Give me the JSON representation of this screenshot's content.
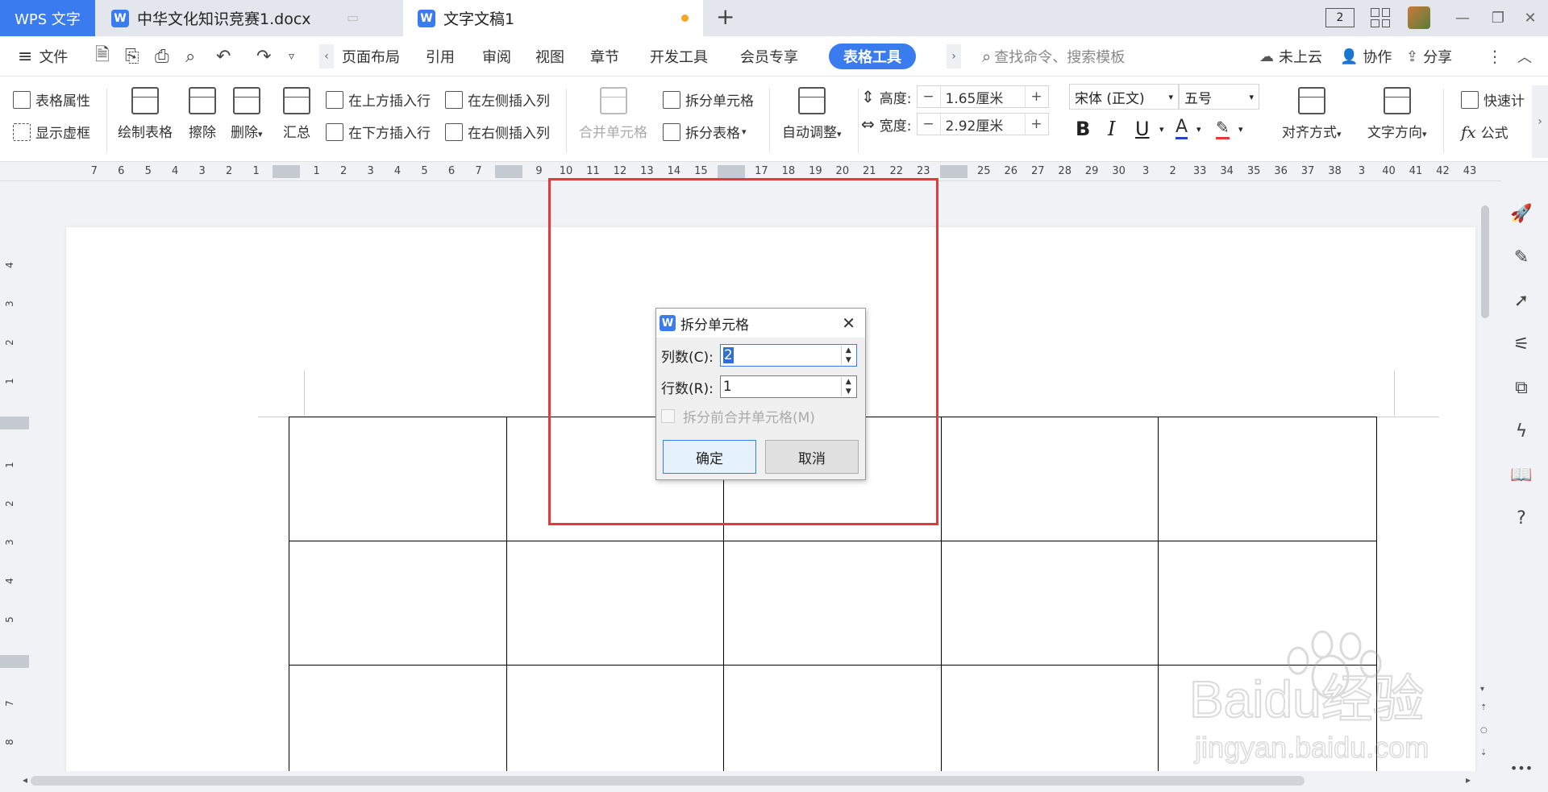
{
  "tabbar": {
    "app_label": "WPS 文字",
    "tabs": [
      {
        "label": "中华文化知识竞赛1.docx"
      },
      {
        "label": "文字文稿1"
      }
    ],
    "new_tab": "+",
    "page_count": "2"
  },
  "menu": {
    "file": "文件",
    "tabs": [
      "页面布局",
      "引用",
      "审阅",
      "视图",
      "章节",
      "开发工具",
      "会员专享",
      "表格工具"
    ],
    "search_placeholder": "查找命令、搜索模板",
    "cloud": "未上云",
    "collab": "协作",
    "share": "分享"
  },
  "ribbon": {
    "table_props": "表格属性",
    "show_grid": "显示虚框",
    "draw_table": "绘制表格",
    "erase": "擦除",
    "delete": "删除",
    "summary": "汇总",
    "insert_above": "在上方插入行",
    "insert_below": "在下方插入行",
    "insert_left": "在左侧插入列",
    "insert_right": "在右侧插入列",
    "merge_cells": "合并单元格",
    "split_cells": "拆分单元格",
    "split_table": "拆分表格",
    "auto_fit": "自动调整",
    "height_label": "高度:",
    "height_value": "1.65厘米",
    "width_label": "宽度:",
    "width_value": "2.92厘米",
    "font": "宋体 (正文)",
    "font_size": "五号",
    "align": "对齐方式",
    "text_direction": "文字方向",
    "quick_calc": "快速计",
    "formula": "公式"
  },
  "ruler": {
    "h_ticks": [
      "7",
      "6",
      "5",
      "4",
      "3",
      "2",
      "1",
      "",
      "1",
      "2",
      "3",
      "4",
      "5",
      "6",
      "7",
      "",
      "9",
      "10",
      "11",
      "12",
      "13",
      "14",
      "15",
      "",
      "17",
      "18",
      "19",
      "20",
      "21",
      "22",
      "23",
      "",
      "25",
      "26",
      "27",
      "28",
      "29",
      "30",
      "3",
      "2",
      "33",
      "34",
      "35",
      "36",
      "37",
      "38",
      "3",
      "40",
      "41",
      "42",
      "43"
    ],
    "v_ticks": [
      "4",
      "3",
      "2",
      "1",
      "",
      "1",
      "2",
      "3",
      "4",
      "5",
      "",
      "7",
      "8"
    ]
  },
  "dialog": {
    "title": "拆分单元格",
    "cols_label": "列数(C):",
    "cols_value": "2",
    "rows_label": "行数(R):",
    "rows_value": "1",
    "merge_before": "拆分前合并单元格(M)",
    "ok": "确定",
    "cancel": "取消"
  },
  "watermark": {
    "brand": "Baidu经验",
    "url": "jingyan.baidu.com"
  },
  "colors": {
    "accent": "#3b7bf0",
    "highlight": "#e8383d"
  }
}
